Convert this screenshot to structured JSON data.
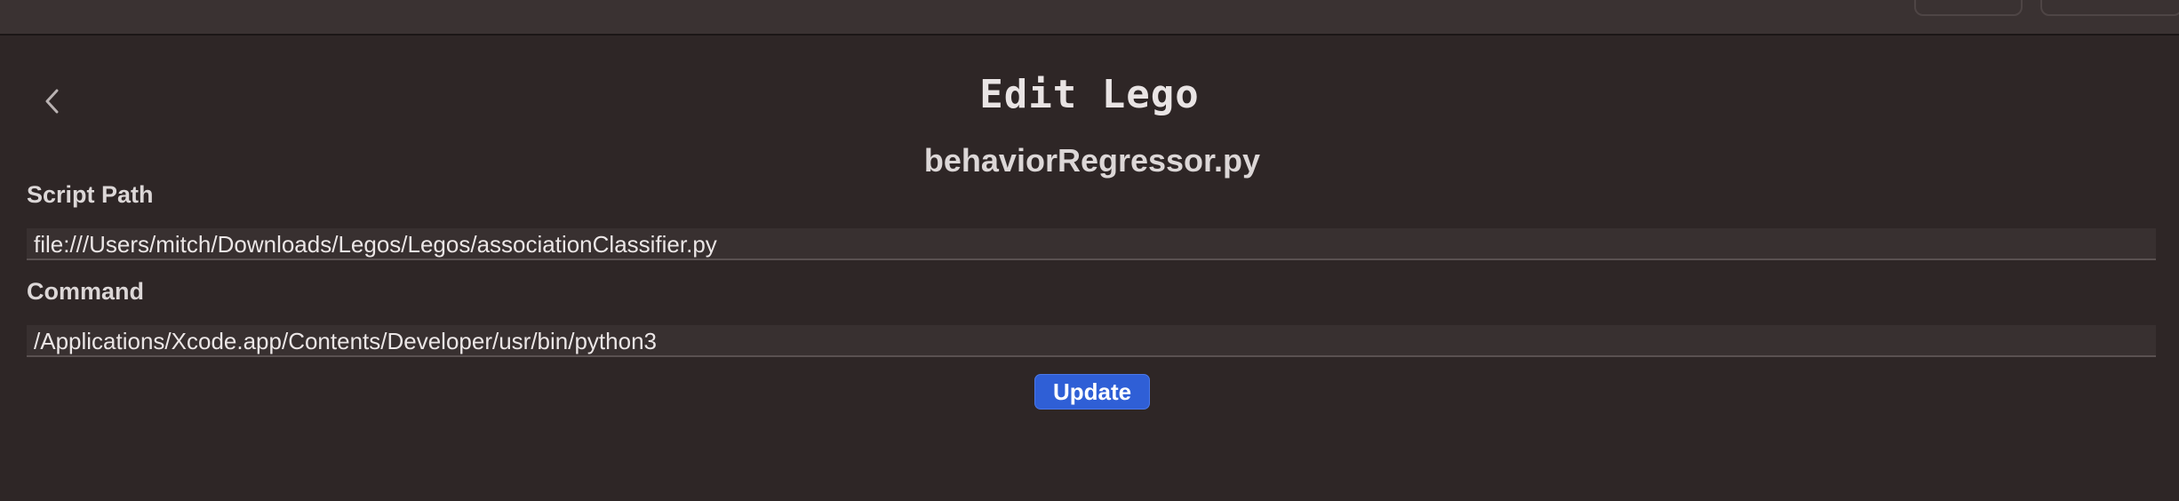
{
  "toolbar": {
    "buttons": [
      "",
      ""
    ]
  },
  "header": {
    "back_icon": "chevron-left-icon",
    "title": "Edit Lego",
    "subtitle": "behaviorRegressor.py"
  },
  "form": {
    "script_path": {
      "label": "Script Path",
      "value": "file:///Users/mitch/Downloads/Legos/Legos/associationClassifier.py"
    },
    "command": {
      "label": "Command",
      "value": "/Applications/Xcode.app/Contents/Developer/usr/bin/python3"
    },
    "update_label": "Update"
  },
  "colors": {
    "background": "#2e2626",
    "field_background": "#383030",
    "accent": "#2f5fd6"
  }
}
